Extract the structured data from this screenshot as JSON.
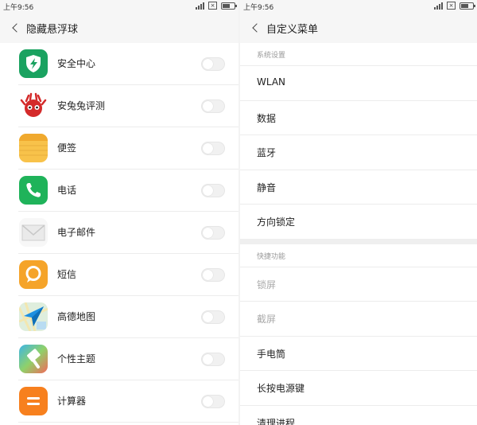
{
  "left": {
    "status": {
      "time": "上午9:56",
      "battery_fraction": 0.65
    },
    "title": "隐藏悬浮球",
    "apps": [
      {
        "label": "安全中心",
        "icon": "shield-icon",
        "enabled": false
      },
      {
        "label": "安兔兔评测",
        "icon": "antutu-icon",
        "enabled": false
      },
      {
        "label": "便签",
        "icon": "notes-icon",
        "enabled": false
      },
      {
        "label": "电话",
        "icon": "phone-icon",
        "enabled": false
      },
      {
        "label": "电子邮件",
        "icon": "mail-icon",
        "enabled": false
      },
      {
        "label": "短信",
        "icon": "message-icon",
        "enabled": false
      },
      {
        "label": "高德地图",
        "icon": "map-icon",
        "enabled": false
      },
      {
        "label": "个性主题",
        "icon": "theme-icon",
        "enabled": false
      },
      {
        "label": "计算器",
        "icon": "calculator-icon",
        "enabled": false
      }
    ]
  },
  "right": {
    "status": {
      "time": "上午9:56",
      "battery_fraction": 0.65
    },
    "title": "自定义菜单",
    "sections": [
      {
        "header": "系统设置",
        "items": [
          {
            "label": "WLAN",
            "disabled": false
          },
          {
            "label": "数据",
            "disabled": false
          },
          {
            "label": "蓝牙",
            "disabled": false
          },
          {
            "label": "静音",
            "disabled": false
          },
          {
            "label": "方向锁定",
            "disabled": false
          }
        ]
      },
      {
        "header": "快捷功能",
        "items": [
          {
            "label": "锁屏",
            "disabled": true
          },
          {
            "label": "截屏",
            "disabled": true
          },
          {
            "label": "手电筒",
            "disabled": false
          },
          {
            "label": "长按电源键",
            "disabled": false
          },
          {
            "label": "清理进程",
            "disabled": false
          }
        ]
      }
    ]
  },
  "colors": {
    "header_bg": "#f6f6f6",
    "divider": "#ececec",
    "toggle_off": "#f1f1f1",
    "section_header": "#999999",
    "disabled_text": "#aaaaaa"
  }
}
